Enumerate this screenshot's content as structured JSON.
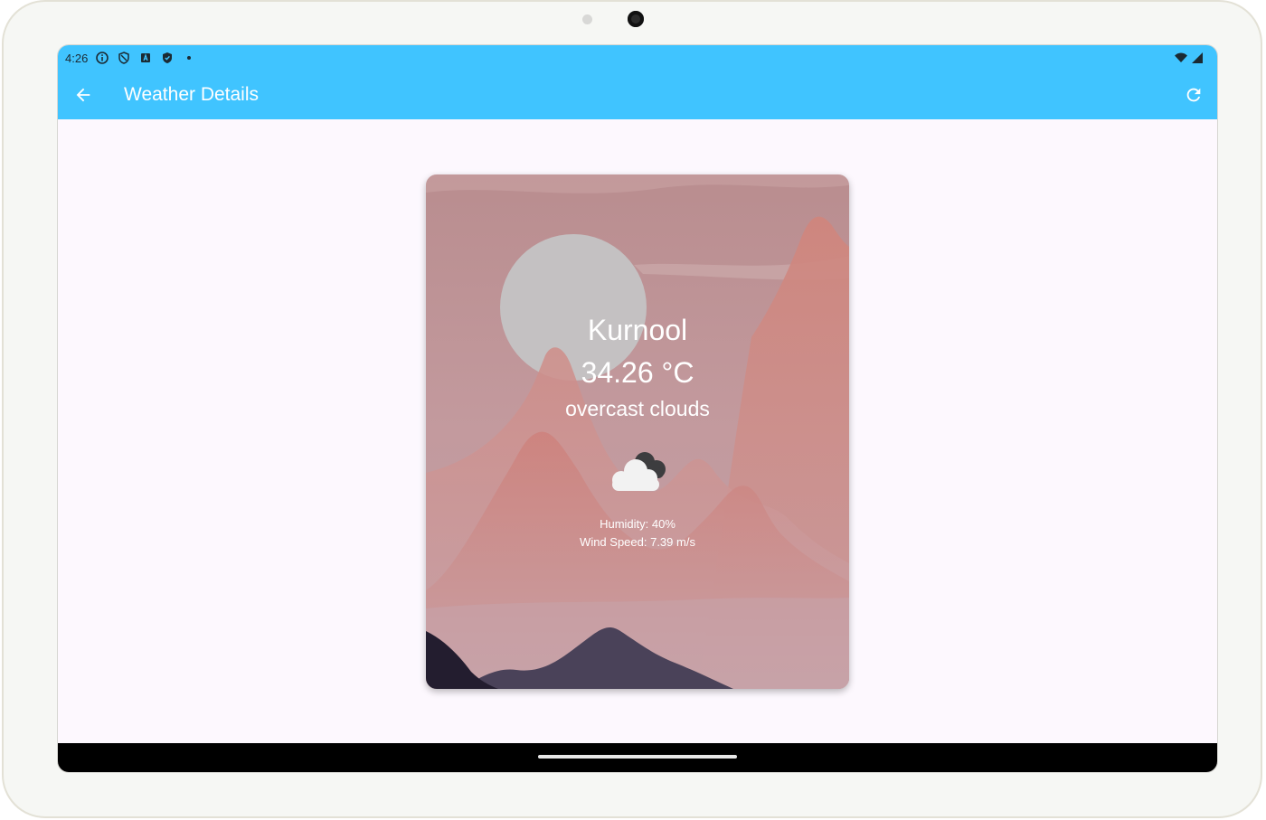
{
  "status_bar": {
    "time": "4:26",
    "left_icons": [
      "info-icon",
      "shield-outline-icon",
      "a-square-icon",
      "shield-check-icon",
      "dot-icon"
    ],
    "right_icons": [
      "wifi-icon",
      "cell-signal-icon"
    ]
  },
  "app_bar": {
    "title": "Weather Details",
    "back_icon": "arrow-back-icon",
    "refresh_icon": "refresh-icon",
    "background_color": "#40c4ff"
  },
  "weather": {
    "city": "Kurnool",
    "temperature": "34.26 °C",
    "description": "overcast clouds",
    "icon": "overcast-clouds-icon",
    "humidity": "Humidity: 40%",
    "wind_speed": "Wind Speed: 7.39 m/s"
  }
}
